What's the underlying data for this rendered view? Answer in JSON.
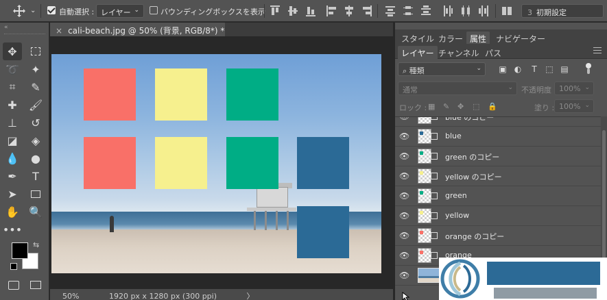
{
  "options_bar": {
    "auto_select_label": "自動選択 :",
    "auto_select_checked": true,
    "auto_select_target": "レイヤー",
    "bounding_box_label": "バウンディングボックスを表示",
    "bounding_box_checked": false,
    "preset_number": "3",
    "preset_label": "初期設定"
  },
  "document": {
    "tab_title": "cali-beach.jpg @ 50% (背景, RGB/8*) *",
    "close_glyph": "×",
    "zoom": "50%",
    "dimensions": "1920 px x 1280 px (300 ppi)",
    "status_arrow": "〉"
  },
  "canvas_squares": [
    {
      "name": "orange-copy-square",
      "color": "#f97068"
    },
    {
      "name": "yellow-copy-square",
      "color": "#f6f08e"
    },
    {
      "name": "green-copy-square",
      "color": "#00ad85"
    },
    {
      "name": "orange-square",
      "color": "#f97068"
    },
    {
      "name": "yellow-square",
      "color": "#f6f08e"
    },
    {
      "name": "green-square",
      "color": "#00ad85"
    },
    {
      "name": "blue-square",
      "color": "#2b6a96"
    },
    {
      "name": "blue-copy-square",
      "color": "#2b6a96"
    }
  ],
  "panels": {
    "top_tabs": [
      "スタイル",
      "カラー",
      "属性",
      "ナビゲーター"
    ],
    "top_active": "属性",
    "layer_tabs": [
      "レイヤー",
      "チャンネル",
      "パス"
    ],
    "layer_active": "レイヤー",
    "filter_kind": "種類",
    "blend_mode": "通常",
    "opacity_label": "不透明度 :",
    "opacity_value": "100%",
    "lock_label": "ロック :",
    "fill_label": "塗り :",
    "fill_value": "100%"
  },
  "layers": [
    {
      "name": "blue のコピー",
      "color": "#2b6a96"
    },
    {
      "name": "blue",
      "color": "#2b6a96"
    },
    {
      "name": "green のコピー",
      "color": "#00ad85"
    },
    {
      "name": "yellow のコピー",
      "color": "#f6f08e"
    },
    {
      "name": "green",
      "color": "#00ad85"
    },
    {
      "name": "yellow",
      "color": "#f6f08e"
    },
    {
      "name": "orange のコピー",
      "color": "#f97068"
    },
    {
      "name": "orange",
      "color": "#f97068"
    }
  ],
  "icons": {
    "eye": "👁",
    "search": "⌕"
  }
}
